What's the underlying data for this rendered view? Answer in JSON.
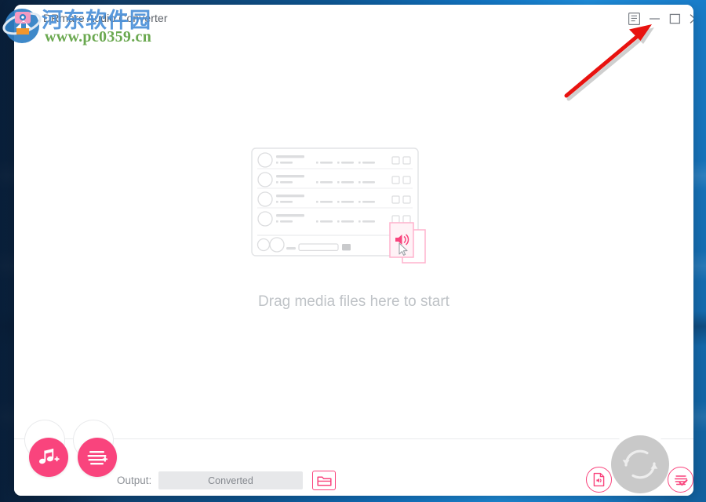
{
  "window": {
    "title": "DRmare Audio Converter",
    "controls": [
      {
        "name": "menu-button",
        "icon": "list-menu-icon"
      },
      {
        "name": "minimize-button",
        "icon": "minimize-icon"
      },
      {
        "name": "maximize-button",
        "icon": "maximize-icon"
      },
      {
        "name": "close-button",
        "icon": "close-icon"
      }
    ]
  },
  "main": {
    "drop_text": "Drag media files here to start",
    "placeholder_icon": "media-list-window-illustration"
  },
  "bottom": {
    "add_music_icon": "music-note-plus-icon",
    "add_list_icon": "playlist-add-icon",
    "output_label": "Output:",
    "output_value": "Converted",
    "folder_icon": "open-folder-icon",
    "convert_icon": "convert-refresh-icon",
    "file_audio_icon": "file-audio-icon",
    "converted_list_icon": "converted-list-check-icon"
  },
  "watermark": {
    "site_name": "河东软件园",
    "url": "www.pc0359.cn",
    "logo_icon": "pc0359-logo-icon"
  },
  "annotation": {
    "arrow_icon": "red-arrow-up-right-icon"
  },
  "colors": {
    "accent": "#f9447d",
    "desktop_blue": "#1277c7",
    "convert_disabled": "#c9c9c9",
    "drop_text": "#bfc3c7",
    "annotation_red": "#e8120f"
  }
}
